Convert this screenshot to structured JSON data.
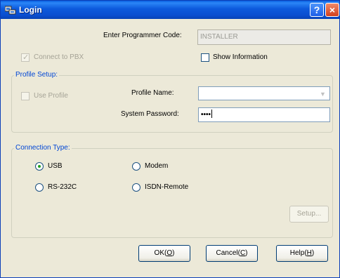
{
  "window": {
    "title": "Login",
    "help_glyph": "?",
    "close_glyph": "×"
  },
  "programmer_code": {
    "label": "Enter Programmer Code:",
    "value": "INSTALLER"
  },
  "connect_to_pbx": {
    "label": "Connect to PBX",
    "checked": true
  },
  "show_information": {
    "label": "Show Information",
    "checked": false
  },
  "profile_setup": {
    "title": "Profile Setup:",
    "use_profile": {
      "label": "Use Profile",
      "checked": false
    },
    "profile_name": {
      "label": "Profile Name:",
      "value": ""
    },
    "system_password": {
      "label": "System Password:",
      "value": "••••"
    }
  },
  "connection_type": {
    "title": "Connection Type:",
    "options": [
      {
        "label": "USB",
        "selected": true
      },
      {
        "label": "Modem",
        "selected": false
      },
      {
        "label": "RS-232C",
        "selected": false
      },
      {
        "label": "ISDN-Remote",
        "selected": false
      }
    ],
    "setup_button": "Setup..."
  },
  "buttons": {
    "ok": {
      "text": "OK(",
      "key": "O",
      "end": ")"
    },
    "cancel": {
      "text": "Cancel(",
      "key": "C",
      "end": ")"
    },
    "help": {
      "text": "Help(",
      "key": "H",
      "end": ")"
    }
  },
  "colors": {
    "title_bar": "#0a5fe0",
    "group_title": "#0046d5",
    "radio_selected": "#21a121",
    "dialog_bg": "#ece9d8"
  },
  "icons": [
    "app-icon",
    "help-icon",
    "close-icon",
    "chevron-down-icon",
    "check-icon"
  ]
}
